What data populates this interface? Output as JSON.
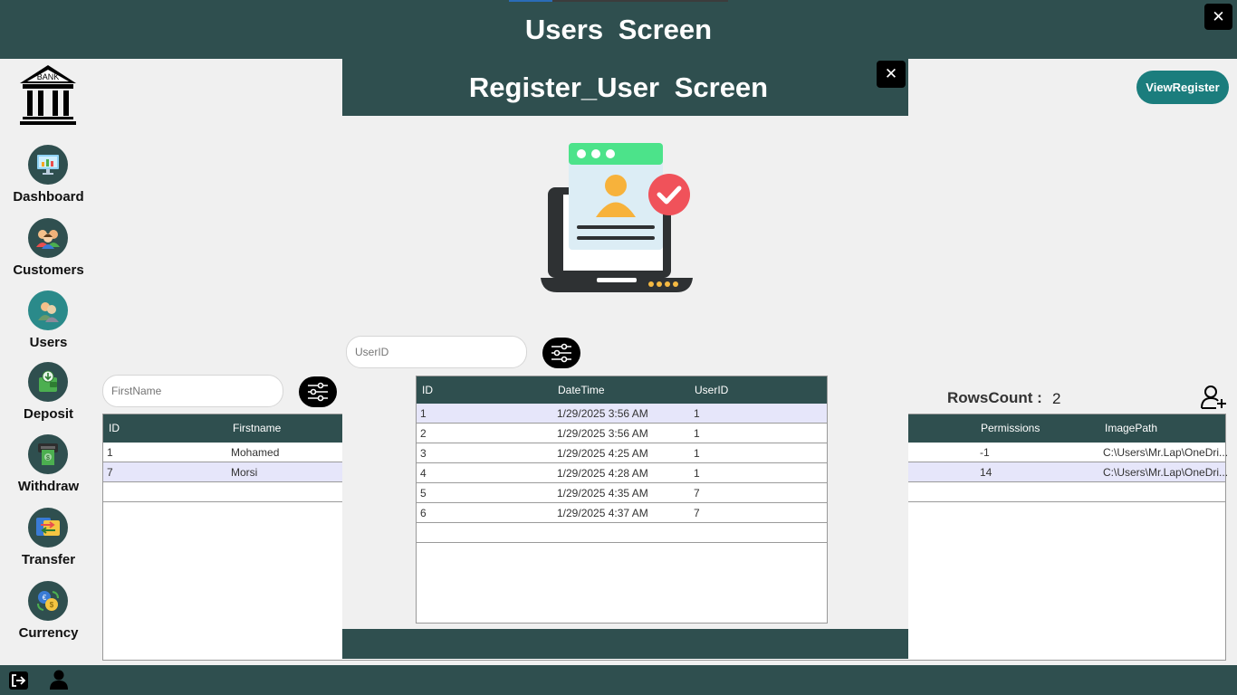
{
  "window": {
    "title": "Users  Screen",
    "close": "✕"
  },
  "sidebar": {
    "logo_text": "BANK",
    "items": [
      {
        "label": "Dashboard"
      },
      {
        "label": "Customers"
      },
      {
        "label": "Users"
      },
      {
        "label": "Deposit"
      },
      {
        "label": "Withdraw"
      },
      {
        "label": "Transfer"
      },
      {
        "label": "Currency"
      }
    ]
  },
  "users": {
    "view_register_label": "ViewRegister",
    "filter_placeholder": "FirstName",
    "rows_count_label": "RowsCount :",
    "rows_count_value": "2",
    "columns": [
      "ID",
      "Firstname",
      "Permissions",
      "ImagePath"
    ],
    "rows": [
      {
        "id": "1",
        "firstname": "Mohamed",
        "permissions": "-1",
        "image_path": "C:\\Users\\Mr.Lap\\OneDri..."
      },
      {
        "id": "7",
        "firstname": "Morsi",
        "permissions": "14",
        "image_path": "C:\\Users\\Mr.Lap\\OneDri..."
      }
    ]
  },
  "register_dialog": {
    "title": "Register_User  Screen",
    "close": "✕",
    "filter_placeholder": "UserID",
    "columns": [
      "ID",
      "DateTime",
      "UserID"
    ],
    "rows": [
      {
        "id": "1",
        "datetime": "1/29/2025 3:56 AM",
        "user_id": "1"
      },
      {
        "id": "2",
        "datetime": "1/29/2025 3:56 AM",
        "user_id": "1"
      },
      {
        "id": "3",
        "datetime": "1/29/2025 4:25 AM",
        "user_id": "1"
      },
      {
        "id": "4",
        "datetime": "1/29/2025 4:28 AM",
        "user_id": "1"
      },
      {
        "id": "5",
        "datetime": "1/29/2025 4:35 AM",
        "user_id": "7"
      },
      {
        "id": "6",
        "datetime": "1/29/2025 4:37 AM",
        "user_id": "7"
      }
    ]
  },
  "colors": {
    "primary": "#2f4f4f",
    "accent": "#1b7d7d",
    "selected_row": "#e6e6fa",
    "check": "#f0525a"
  }
}
